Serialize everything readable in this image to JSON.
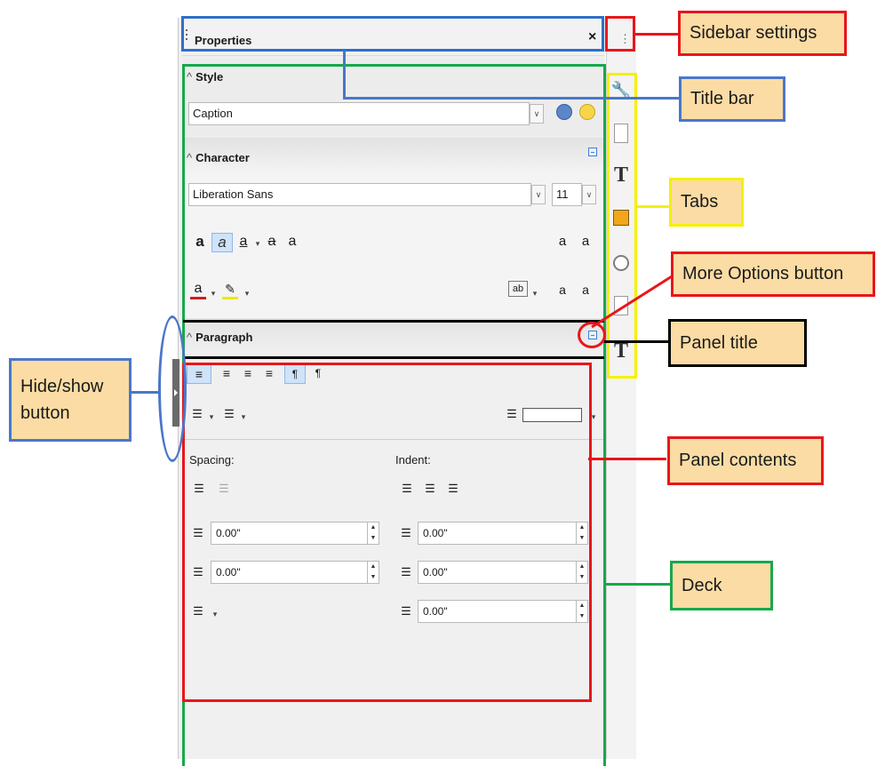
{
  "sidebar": {
    "title": "Properties",
    "close_symbol": "×",
    "settings_symbol": "⋮"
  },
  "style_panel": {
    "title": "Style",
    "style_value": "Caption"
  },
  "character_panel": {
    "title": "Character",
    "font_name": "Liberation Sans",
    "font_size": "11"
  },
  "paragraph_panel": {
    "title": "Paragraph",
    "spacing_label": "Spacing:",
    "indent_label": "Indent:",
    "above_spacing": "0.00\"",
    "below_spacing": "0.00\"",
    "before_indent": "0.00\"",
    "after_indent": "0.00\"",
    "first_line_indent": "0.00\""
  },
  "tabs": [
    {
      "icon": "wrench-icon"
    },
    {
      "icon": "page-icon"
    },
    {
      "icon": "styles-icon"
    },
    {
      "icon": "gallery-icon"
    },
    {
      "icon": "navigator-icon"
    },
    {
      "icon": "manage-changes-icon"
    },
    {
      "icon": "design-icon"
    }
  ],
  "callouts": {
    "sidebar_settings": "Sidebar settings",
    "title_bar": "Title bar",
    "tabs": "Tabs",
    "more_options": "More Options button",
    "panel_title": "Panel title",
    "hide_show": "Hide/show button",
    "panel_contents": "Panel contents",
    "deck": "Deck"
  },
  "colors": {
    "blue_box": "#2e6fc9",
    "green_box": "#17a84b",
    "red_box": "#e8161b",
    "yellow_box": "#f5f000",
    "black_box": "#000000",
    "callout_fill": "#fbdca4"
  }
}
